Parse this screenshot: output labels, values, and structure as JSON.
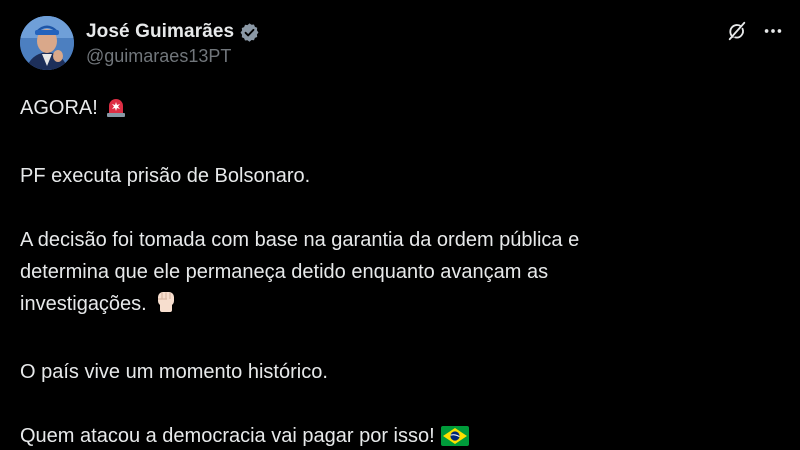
{
  "author": {
    "display_name": "José Guimarães",
    "handle": "@guimaraes13PT",
    "verified": true,
    "verified_icon": "verified-badge-icon",
    "verified_color": "#71767b"
  },
  "actions": {
    "grok_icon": "grok-icon",
    "more_icon": "more-icon"
  },
  "post": {
    "line_1": "AGORA!",
    "line_1_emoji": "rotating-light-emoji",
    "line_2": "PF executa prisão de Bolsonaro.",
    "line_3a": "A decisão foi tomada com base na garantia da ordem pública e",
    "line_3b": "determina que ele permaneça detido enquanto avançam as",
    "line_3c": "investigações.",
    "line_3_emoji": "raised-fist-emoji",
    "line_4": "O país vive um momento histórico.",
    "line_5": "Quem atacou a democracia vai pagar por isso!",
    "line_5_emoji": "brazil-flag-emoji"
  },
  "colors": {
    "background": "#000000",
    "text": "#e7e9ea",
    "secondary_text": "#71767b"
  }
}
